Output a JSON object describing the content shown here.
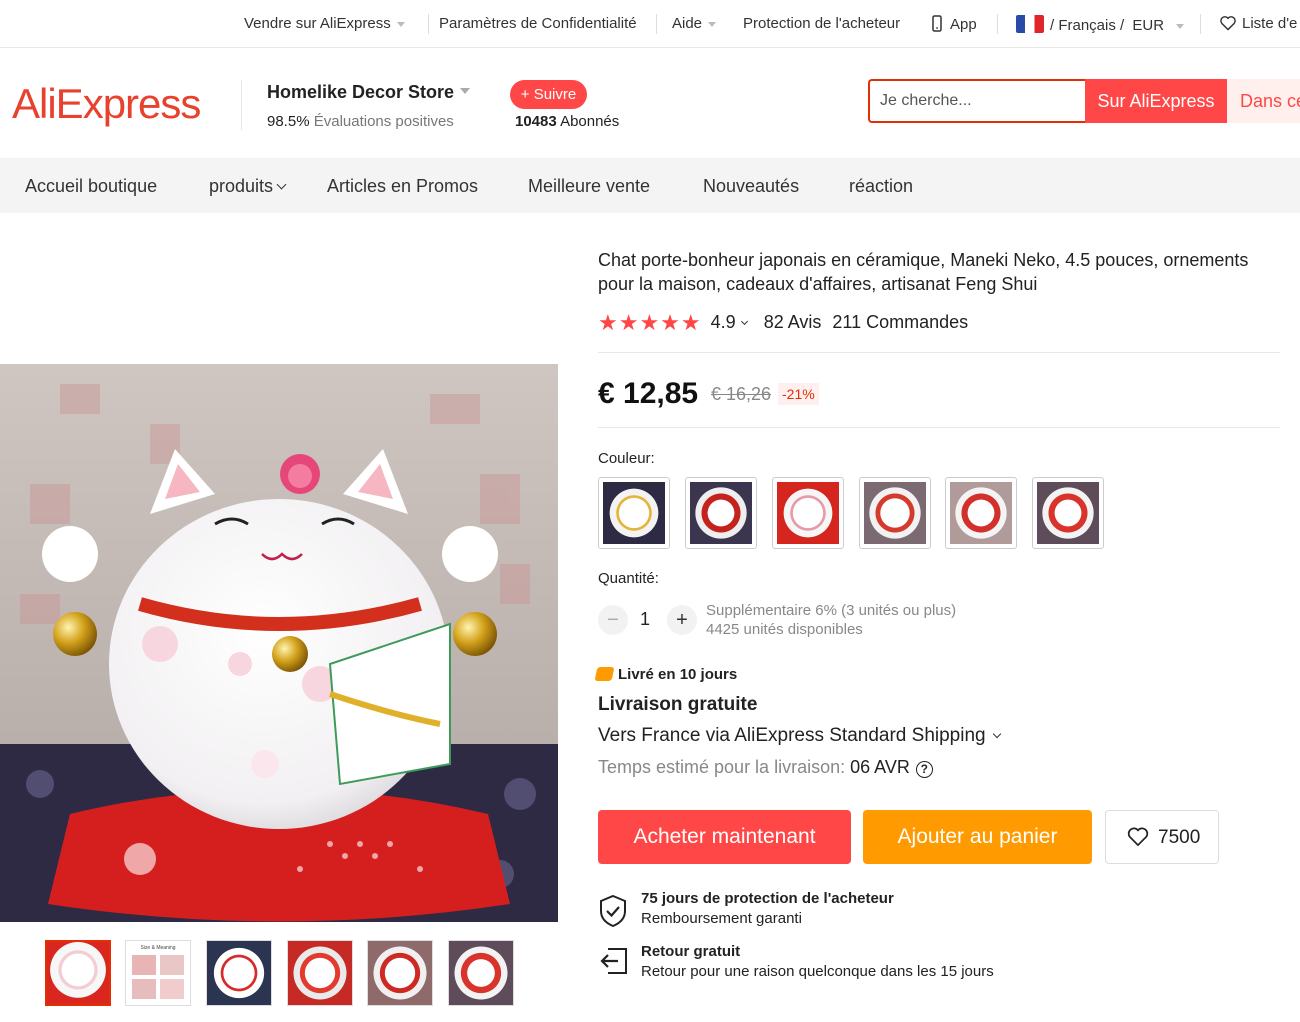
{
  "topbar": {
    "sell": "Vendre sur AliExpress",
    "privacy": "Paramètres de Confidentialité",
    "help": "Aide",
    "buyer_protection": "Protection de l'acheteur",
    "app": "App",
    "language": "/ Français /",
    "currency": "EUR",
    "wishlist": "Liste d'e"
  },
  "header": {
    "logo": "AliExpress",
    "store_name": "Homelike Decor Store",
    "rating_value": "98.5%",
    "rating_label": "Évaluations positives",
    "follow_label": "+ Suivre",
    "followers_count": "10483",
    "followers_label": "Abonnés",
    "search_placeholder": "Je cherche...",
    "search_btn_all": "Sur AliExpress",
    "search_btn_store": "Dans ce"
  },
  "store_nav": {
    "items": [
      "Accueil boutique",
      "produits",
      "Articles en Promos",
      "Meilleure vente",
      "Nouveautés",
      "réaction"
    ]
  },
  "product": {
    "title": "Chat porte-bonheur japonais en céramique, Maneki Neko, 4.5 pouces, ornements pour la maison, cadeaux d'affaires, artisanat Feng Shui",
    "stars": "★★★★★",
    "rating": "4.9",
    "reviews": "82 Avis",
    "orders": "211 Commandes",
    "price": "€ 12,85",
    "old_price": "€ 16,26",
    "discount": "-21%",
    "color_label": "Couleur:",
    "quantity_label": "Quantité:",
    "quantity_minus": "−",
    "quantity_value": "1",
    "quantity_plus": "+",
    "quantity_note_1": "Supplémentaire 6% (3 unités ou plus)",
    "quantity_note_2": "4425 unités disponibles",
    "delivery_badge": "Livré en 10 jours",
    "free_shipping": "Livraison gratuite",
    "ship_via": "Vers France via AliExpress Standard Shipping",
    "eta_label": "Temps estimé pour la livraison:",
    "eta_value": "06 AVR",
    "help_mark": "?",
    "buy_now": "Acheter maintenant",
    "add_to_cart": "Ajouter au panier",
    "wish_count": "7500"
  },
  "guarantees": [
    {
      "title": "75 jours de protection de l'acheteur",
      "subtitle": "Remboursement garanti"
    },
    {
      "title": "Retour gratuit",
      "subtitle": "Retour pour une raison quelconque dans les 15 jours"
    }
  ],
  "thumbnail_label": "Size & Meaning",
  "colors": {
    "accent": "#ff4747",
    "cart": "#ff9a00",
    "logo": "#e8412e"
  }
}
